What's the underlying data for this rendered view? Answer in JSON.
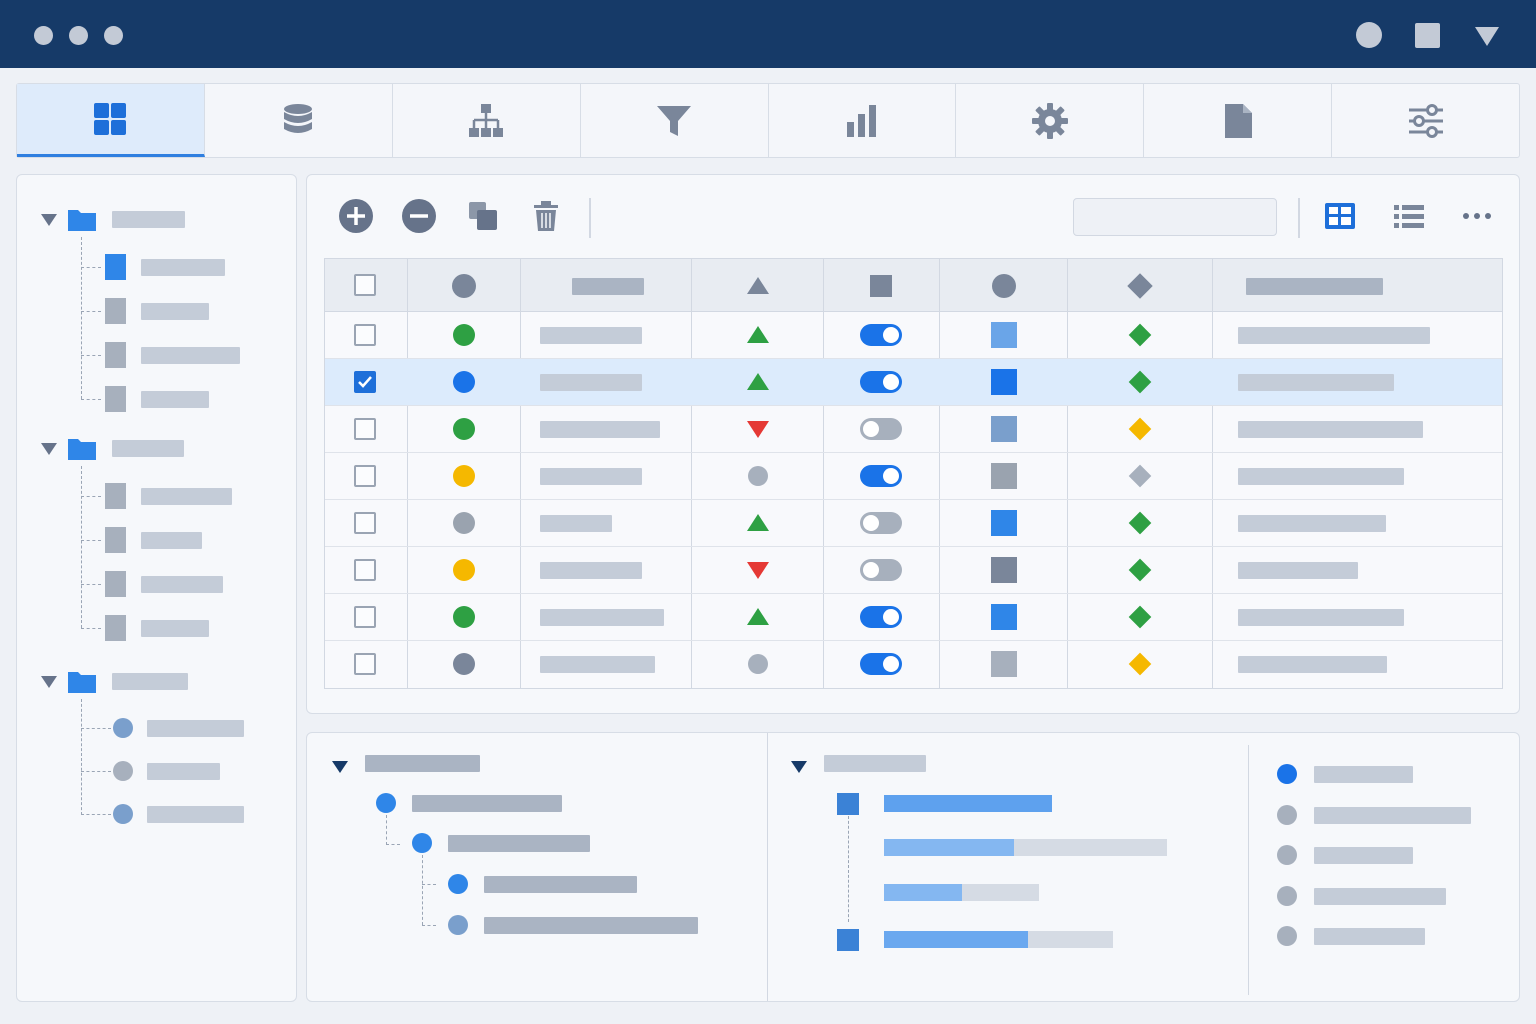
{
  "window": {
    "controls": [
      "circle-icon",
      "square-icon",
      "dropdown-triangle-icon"
    ]
  },
  "tabs": [
    {
      "icon": "dashboard-grid-icon",
      "active": true
    },
    {
      "icon": "database-icon",
      "active": false
    },
    {
      "icon": "hierarchy-icon",
      "active": false
    },
    {
      "icon": "filter-icon",
      "active": false
    },
    {
      "icon": "bar-chart-icon",
      "active": false
    },
    {
      "icon": "gear-icon",
      "active": false
    },
    {
      "icon": "document-icon",
      "active": false
    },
    {
      "icon": "sliders-icon",
      "active": false
    }
  ],
  "sidebar": {
    "groups": [
      {
        "expanded": true,
        "item_icon": "file-icon",
        "item_count": 4
      },
      {
        "expanded": true,
        "item_icon": "file-icon",
        "item_count": 4
      },
      {
        "expanded": true,
        "item_icon": "dot-icon",
        "item_count": 3
      }
    ]
  },
  "toolbar": {
    "actions": [
      "add-icon",
      "remove-icon",
      "copy-icon",
      "delete-icon"
    ],
    "view_modes": [
      "grid-view-icon",
      "list-view-icon",
      "more-icon"
    ],
    "search": {
      "value": "",
      "placeholder": ""
    }
  },
  "table": {
    "header_icons": [
      "checkbox",
      "circle",
      "text",
      "triangle",
      "square",
      "circle",
      "diamond",
      "text"
    ],
    "rows": [
      {
        "checked": false,
        "status": "#2ea043",
        "trend": "up",
        "toggle": true,
        "square": "#6aa5e8",
        "diamond": "#2ea043"
      },
      {
        "checked": true,
        "status": "#1a73e8",
        "trend": "up",
        "toggle": true,
        "square": "#1a73e8",
        "diamond": "#2ea043"
      },
      {
        "checked": false,
        "status": "#2ea043",
        "trend": "down",
        "toggle": false,
        "square": "#7a9fcc",
        "diamond": "#f5b800"
      },
      {
        "checked": false,
        "status": "#f5b800",
        "trend": "neutral",
        "toggle": true,
        "square": "#9aa3af",
        "diamond": "#a7b0bd"
      },
      {
        "checked": false,
        "status": "#9aa3af",
        "trend": "up",
        "toggle": false,
        "square": "#2f86e8",
        "diamond": "#2ea043"
      },
      {
        "checked": false,
        "status": "#f5b800",
        "trend": "down",
        "toggle": false,
        "square": "#7a869a",
        "diamond": "#2ea043"
      },
      {
        "checked": false,
        "status": "#2ea043",
        "trend": "up",
        "toggle": true,
        "square": "#2f86e8",
        "diamond": "#2ea043"
      },
      {
        "checked": false,
        "status": "#7a869a",
        "trend": "neutral",
        "toggle": true,
        "square": "#a7b0bd",
        "diamond": "#f5b800"
      }
    ]
  },
  "bottom": {
    "tree_expanded": true,
    "timeline_expanded": true,
    "legend_items": 5,
    "progress": [
      0.6,
      0.46,
      0.5,
      0.63
    ]
  },
  "colors": {
    "accent": "#1a73e8",
    "titlebar": "#163a68",
    "success": "#2ea043",
    "warning": "#f5b800",
    "danger": "#e53935"
  }
}
